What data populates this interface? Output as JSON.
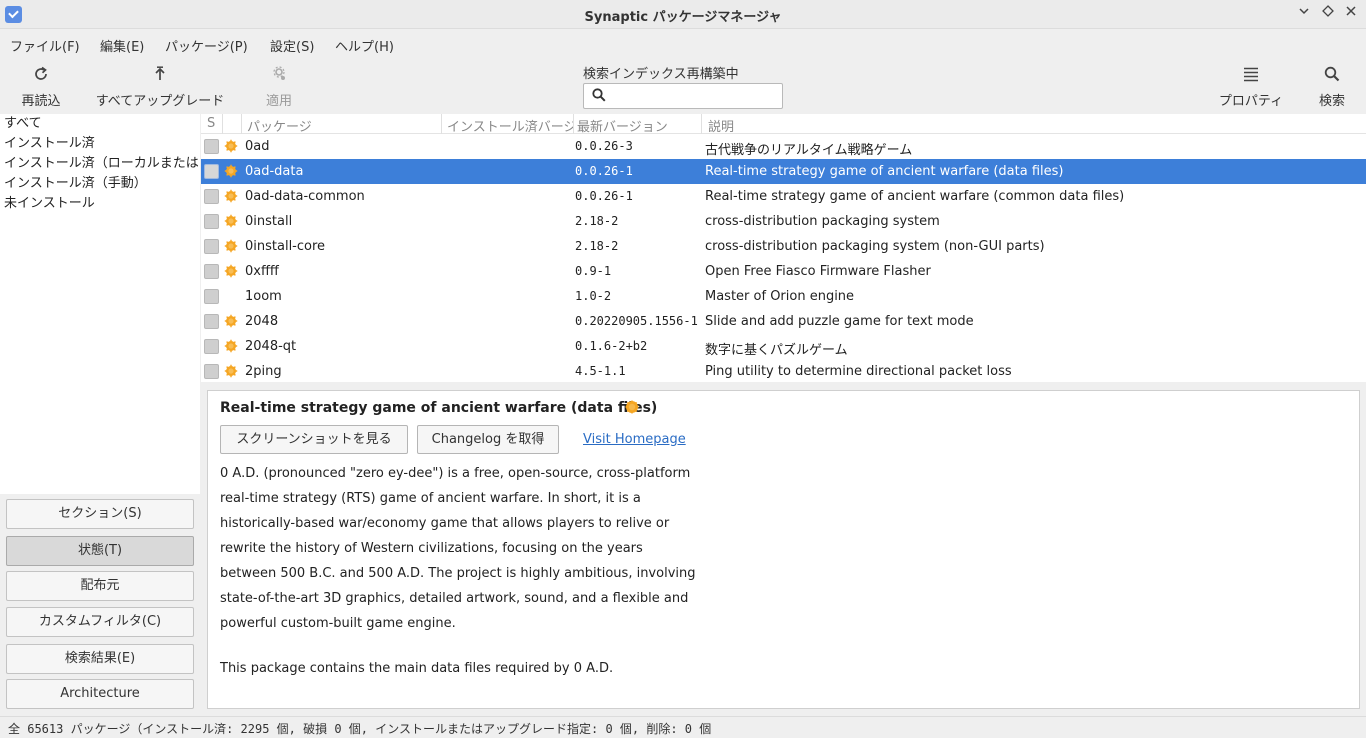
{
  "window": {
    "title": "Synaptic パッケージマネージャ",
    "controls": [
      "minimize-icon",
      "maximize-icon",
      "close-icon"
    ]
  },
  "menu": {
    "file": "ファイル(F)",
    "edit": "編集(E)",
    "package": "パッケージ(P)",
    "settings": "設定(S)",
    "help": "ヘルプ(H)"
  },
  "toolbar": {
    "reload": "再読込",
    "upgrade_all": "すべてアップグレード",
    "apply": "適用",
    "search_caption": "検索インデックス再構築中",
    "search_value": "",
    "properties": "プロパティ",
    "search": "検索"
  },
  "filters": {
    "items": [
      {
        "label": "すべて",
        "selected": true
      },
      {
        "label": "インストール済",
        "selected": false
      },
      {
        "label": "インストール済（ローカルまたは",
        "selected": false
      },
      {
        "label": "インストール済（手動）",
        "selected": false
      },
      {
        "label": "未インストール",
        "selected": false
      }
    ]
  },
  "side_buttons": {
    "sections": "セクション(S)",
    "status": "状態(T)",
    "origin": "配布元",
    "custom": "カスタムフィルタ(C)",
    "search_results": "検索結果(E)",
    "architecture": "Architecture",
    "active": "status"
  },
  "table": {
    "headers": {
      "s": "S",
      "package": "パッケージ",
      "installed": "インストール済バージ",
      "latest": "最新バージョン",
      "description": "説明"
    },
    "rows": [
      {
        "support": true,
        "name": "0ad",
        "installed": "",
        "latest": "0.0.26-3",
        "description": "古代戦争のリアルタイム戦略ゲーム",
        "selected": false
      },
      {
        "support": true,
        "name": "0ad-data",
        "installed": "",
        "latest": "0.0.26-1",
        "description": "Real-time strategy game of ancient warfare (data files)",
        "selected": true
      },
      {
        "support": true,
        "name": "0ad-data-common",
        "installed": "",
        "latest": "0.0.26-1",
        "description": "Real-time strategy game of ancient warfare (common data files)",
        "selected": false
      },
      {
        "support": true,
        "name": "0install",
        "installed": "",
        "latest": "2.18-2",
        "description": "cross-distribution packaging system",
        "selected": false
      },
      {
        "support": true,
        "name": "0install-core",
        "installed": "",
        "latest": "2.18-2",
        "description": "cross-distribution packaging system (non-GUI parts)",
        "selected": false
      },
      {
        "support": true,
        "name": "0xffff",
        "installed": "",
        "latest": "0.9-1",
        "description": "Open Free Fiasco Firmware Flasher",
        "selected": false
      },
      {
        "support": false,
        "name": "1oom",
        "installed": "",
        "latest": "1.0-2",
        "description": "Master of Orion engine",
        "selected": false
      },
      {
        "support": true,
        "name": "2048",
        "installed": "",
        "latest": "0.20220905.1556-1",
        "description": "Slide and add puzzle game for text mode",
        "selected": false
      },
      {
        "support": true,
        "name": "2048-qt",
        "installed": "",
        "latest": "0.1.6-2+b2",
        "description": "数字に基くパズルゲーム",
        "selected": false
      },
      {
        "support": true,
        "name": "2ping",
        "installed": "",
        "latest": "4.5-1.1",
        "description": "Ping utility to determine directional packet loss",
        "selected": false
      }
    ]
  },
  "details": {
    "title": "Real-time strategy game of ancient warfare (data files)",
    "screenshot_button": "スクリーンショットを見る",
    "changelog_button": "Changelog を取得",
    "homepage_link": "Visit Homepage",
    "description_p1": "0 A.D. (pronounced \"zero ey-dee\") is a free, open-source, cross-platform real-time strategy (RTS) game of ancient warfare. In short, it is a historically-based war/economy game that allows players to relive or rewrite the history of Western civilizations, focusing on the years between 500 B.C. and 500 A.D. The project is highly ambitious, involving state-of-the-art 3D graphics, detailed artwork, sound, and a flexible and powerful custom-built game engine.",
    "description_p2": "This package contains the main data files required by 0 A.D."
  },
  "status": {
    "text": "全 65613 パッケージ（インストール済: 2295 個, 破損 0 個, インストールまたはアップグレード指定: 0 個, 削除: 0 個"
  },
  "colors": {
    "selection": "#3d7fd9",
    "support_icon": "#f5a623",
    "link": "#2a6cc4"
  }
}
